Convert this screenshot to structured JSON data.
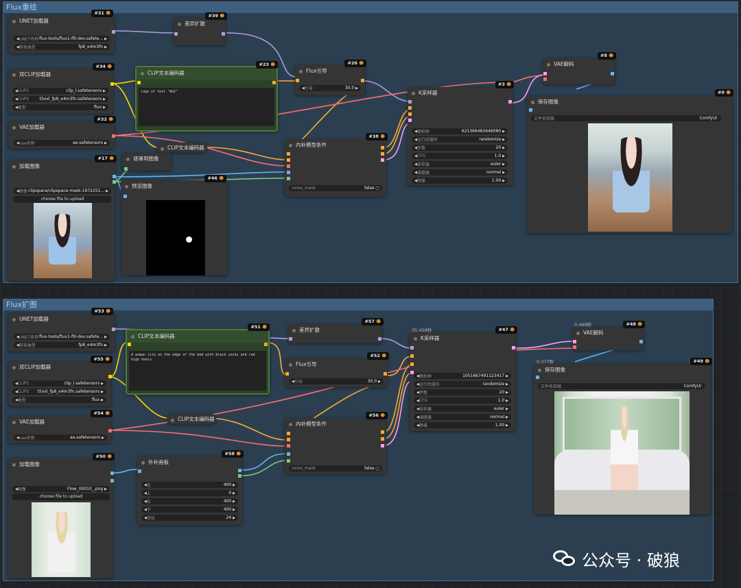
{
  "groups": [
    {
      "title": "Flux重绘"
    },
    {
      "title": "Flux扩图"
    }
  ],
  "top": {
    "unet": {
      "title": "UNET加载器",
      "id": "#31",
      "name_label": "UNET名称",
      "name_value": "flux-tools/flux1-fill-dev.safete...",
      "dtype_label": "剪枝类型",
      "dtype_value": "fp8_e4m3fn"
    },
    "diff": {
      "title": "差异扩散",
      "id": "#39"
    },
    "dualclip": {
      "title": "双CLIP加载器",
      "id": "#34",
      "clip1_label": "CLIP1",
      "clip1_value": "clip_l.safetensors",
      "clip2_label": "CLIP2",
      "clip2_value": "t5xxl_fp8_e4m3fn.safetensors",
      "type_label": "类型",
      "type_value": "flux"
    },
    "cliptext": {
      "title": "CLIP文本编码器",
      "id": "#23",
      "text": "logo of text \"AGI\""
    },
    "fluxguide": {
      "title": "Flux引导",
      "id": "#26",
      "label": "引导",
      "value": "30.0"
    },
    "vae": {
      "title": "VAE加载器",
      "id": "#32",
      "label": "vae名称",
      "value": "ae.safetensors"
    },
    "clipneg": {
      "title": "CLIP文本编码器"
    },
    "loadimg": {
      "title": "加载图像",
      "id": "#17",
      "img_label": "图像",
      "img_value": "clipspace/clipspace-mask-1972251...",
      "upload": "choose file to upload"
    },
    "mask": {
      "title": "遮罩到图像"
    },
    "preview": {
      "title": "预览图像",
      "id": "#46"
    },
    "inpaint": {
      "title": "内补模型条件",
      "id": "#38",
      "noise_label": "noise_mask",
      "noise_value": "false"
    },
    "ksampler": {
      "title": "K采样器",
      "id": "#3",
      "rows": [
        {
          "label": "随机种",
          "value": "621366483646080"
        },
        {
          "label": "运行后操作",
          "value": "randomize"
        },
        {
          "label": "步数",
          "value": "20"
        },
        {
          "label": "CFG",
          "value": "1.0"
        },
        {
          "label": "采样器",
          "value": "euler"
        },
        {
          "label": "调度器",
          "value": "normal"
        },
        {
          "label": "降噪",
          "value": "1.00"
        }
      ]
    },
    "vaedecode": {
      "title": "VAE解码",
      "id": "#8"
    },
    "save": {
      "title": "保存图像",
      "id": "#9",
      "prefix_label": "文件名前缀",
      "prefix_value": "ComfyUI"
    }
  },
  "bottom": {
    "unet": {
      "title": "UNET加载器",
      "id": "#53",
      "name_label": "UNET名称",
      "name_value": "flux-tools/flux1-fill-dev.safete...",
      "dtype_label": "剪枝类型",
      "dtype_value": "fp8_e4m3fn"
    },
    "cliptext": {
      "title": "CLIP文本编码器",
      "id": "#51",
      "text": "A woman sits on the edge of the bed with black socks and red high heels"
    },
    "diff": {
      "title": "差异扩散",
      "id": "#57"
    },
    "dualclip": {
      "title": "双CLIP加载器",
      "id": "#55",
      "clip1_label": "CLIP1",
      "clip1_value": "clip_l.safetensors",
      "clip2_label": "CLIP2",
      "clip2_value": "t5xxl_fp8_e4m3fn.safetensors",
      "type_label": "类型",
      "type_value": "flux"
    },
    "fluxguide": {
      "title": "Flux引导",
      "id": "#52",
      "label": "引导",
      "value": "30.0"
    },
    "vae": {
      "title": "VAE加载器",
      "id": "#54",
      "label": "vae名称",
      "value": "ae.safetensors"
    },
    "clipneg": {
      "title": "CLIP文本编码器"
    },
    "inpaint": {
      "title": "内补模型条件",
      "id": "#56",
      "noise_label": "noise_mask",
      "noise_value": "false"
    },
    "loadimg": {
      "title": "加载图像",
      "id": "#50",
      "img_label": "图像",
      "img_value": "Flow_00010_.png",
      "upload": "choose file to upload"
    },
    "pad": {
      "title": "外补画板",
      "id": "#58",
      "rows": [
        {
          "label": "左",
          "value": "400"
        },
        {
          "label": "上",
          "value": "0"
        },
        {
          "label": "右",
          "value": "400"
        },
        {
          "label": "下",
          "value": "400"
        },
        {
          "label": "羽化",
          "value": "24"
        }
      ]
    },
    "ksampler": {
      "title": "K采样器",
      "id": "#47",
      "timer": "35.458秒",
      "rows": [
        {
          "label": "随机种",
          "value": "1051667491123417"
        },
        {
          "label": "运行后操作",
          "value": "randomize"
        },
        {
          "label": "步数",
          "value": "20"
        },
        {
          "label": "CFG",
          "value": "1.0"
        },
        {
          "label": "采样器",
          "value": "euler"
        },
        {
          "label": "调度器",
          "value": "normal"
        },
        {
          "label": "降噪",
          "value": "1.00"
        }
      ]
    },
    "vaedecode": {
      "title": "VAE解码",
      "id": "#48",
      "timer": "0.488秒"
    },
    "save": {
      "title": "保存图像",
      "id": "#49",
      "timer": "0.377秒",
      "prefix_label": "文件名前缀",
      "prefix_value": "ComfyUI"
    }
  },
  "watermark": {
    "text": "公众号 · 破狼"
  },
  "colors": {
    "model": "#b39ddb",
    "clip": "#ffd500",
    "vae": "#ff6e6e",
    "cond": "#ffa931",
    "latent": "#ff9cf9",
    "image": "#64b5f6",
    "mask": "#81c784"
  }
}
